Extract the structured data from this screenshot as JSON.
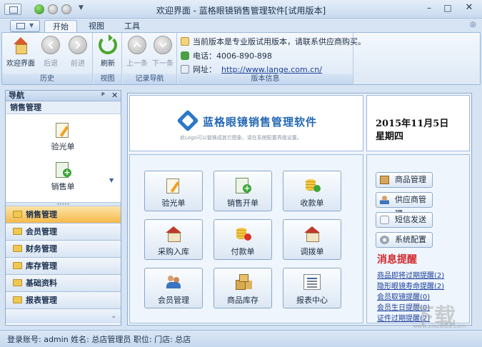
{
  "window": {
    "title": "欢迎界面 - 蓝格眼镜销售管理软件[试用版本]",
    "min_symbol": "–",
    "max_symbol": "□",
    "close_symbol": "✕"
  },
  "quick_access": {
    "dropdown_symbol": "▼"
  },
  "menu": {
    "caret": "▼",
    "help_symbol": "◎"
  },
  "tabs": [
    {
      "label": "开始",
      "active": true
    },
    {
      "label": "视图",
      "active": false
    },
    {
      "label": "工具",
      "active": false
    }
  ],
  "ribbon": {
    "groups": {
      "history": "历史",
      "view": "视图",
      "record_nav": "记录导航",
      "version_info": "版本信息"
    },
    "buttons": {
      "welcome": "欢迎界面",
      "back": "后退",
      "forward": "前进",
      "refresh": "刷新",
      "prev": "上一条",
      "next": "下一条"
    },
    "info": {
      "notice": "当前版本是专业版试用版本，请联系供应商购买。",
      "phone_label": "电话：",
      "phone": "4006-890-898",
      "web_label": "网址：",
      "url": "http://www.lange.com.cn/"
    }
  },
  "nav": {
    "title": "导航",
    "pin": "ᵖ",
    "close": "✕",
    "section": "销售管理",
    "items": [
      "验光单",
      "销售单"
    ],
    "more": "▼",
    "grip": "•••••",
    "categories": [
      {
        "label": "销售管理",
        "active": true
      },
      {
        "label": "会员管理",
        "active": false
      },
      {
        "label": "财务管理",
        "active": false
      },
      {
        "label": "库存管理",
        "active": false
      },
      {
        "label": "基础资料",
        "active": false
      },
      {
        "label": "报表管理",
        "active": false
      }
    ],
    "footer": "⌄"
  },
  "home": {
    "logo_text": "蓝格眼镜销售管理软件",
    "logo_hint": "此Logo可以替换成其它图象，请在系统配置界面设置。",
    "date": "2015年11月5日",
    "weekday": "星期四",
    "functions": [
      "验光单",
      "销售开单",
      "收款单",
      "采购入库",
      "付款单",
      "调拨单",
      "会员管理",
      "商品库存",
      "报表中心"
    ],
    "side_buttons": [
      "商品管理",
      "供应商管理",
      "短信发送",
      "系统配置"
    ],
    "alerts_title": "消息提醒",
    "alerts": [
      "商品即将过期提醒(2)",
      "隐形眼镜寿命提醒(2)",
      "会员取镜提醒(0)",
      "会员生日提醒(0)",
      "证件过期提醒(2)"
    ]
  },
  "status": {
    "text": "登录账号: admin  姓名: 总店管理员  职位:  门店: 总店"
  },
  "watermark": {
    "text": "下载",
    "sub": "www.xiazaiba.com"
  }
}
